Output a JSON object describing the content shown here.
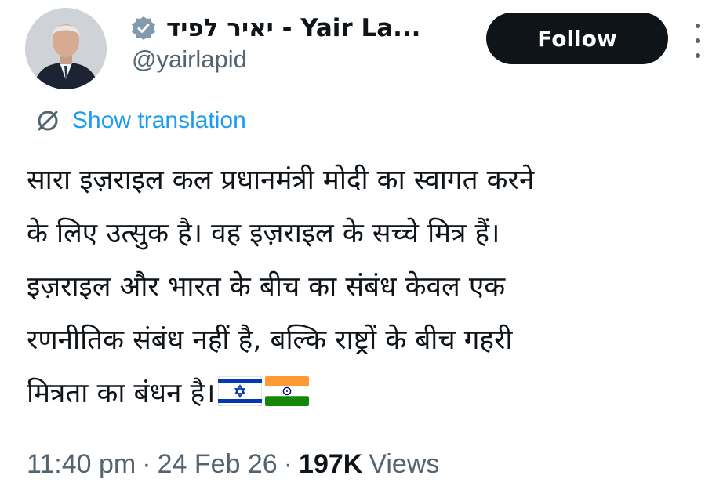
{
  "header": {
    "display_name": "יאיר לפיד - Yair La...",
    "handle": "@yairlapid",
    "verified_icon": "verified-badge-icon",
    "follow_label": "Follow",
    "more_icon": "more-vertical-icon"
  },
  "translation": {
    "icon": "translate-icon",
    "label": "Show translation"
  },
  "tweet": {
    "lines": [
      "सारा इज़राइल कल प्रधानमंत्री मोदी का स्वागत करने",
      "के लिए उत्सुक है। वह इज़राइल के सच्चे मित्र हैं।",
      "इज़राइल और भारत के बीच का संबंध केवल एक",
      "रणनीतिक संबंध नहीं है, बल्कि राष्ट्रों के बीच गहरी",
      "मित्रता का बंधन है।"
    ],
    "flags": [
      "flag-israel-icon",
      "flag-india-icon"
    ]
  },
  "meta": {
    "time": "11:40 pm",
    "separator": "·",
    "date": "24 Feb 26",
    "views_count": "197K",
    "views_label": "Views"
  },
  "colors": {
    "text": "#0f1419",
    "secondary": "#536471",
    "link": "#1d9bf0",
    "button_bg": "#0f1419",
    "button_text": "#ffffff"
  }
}
